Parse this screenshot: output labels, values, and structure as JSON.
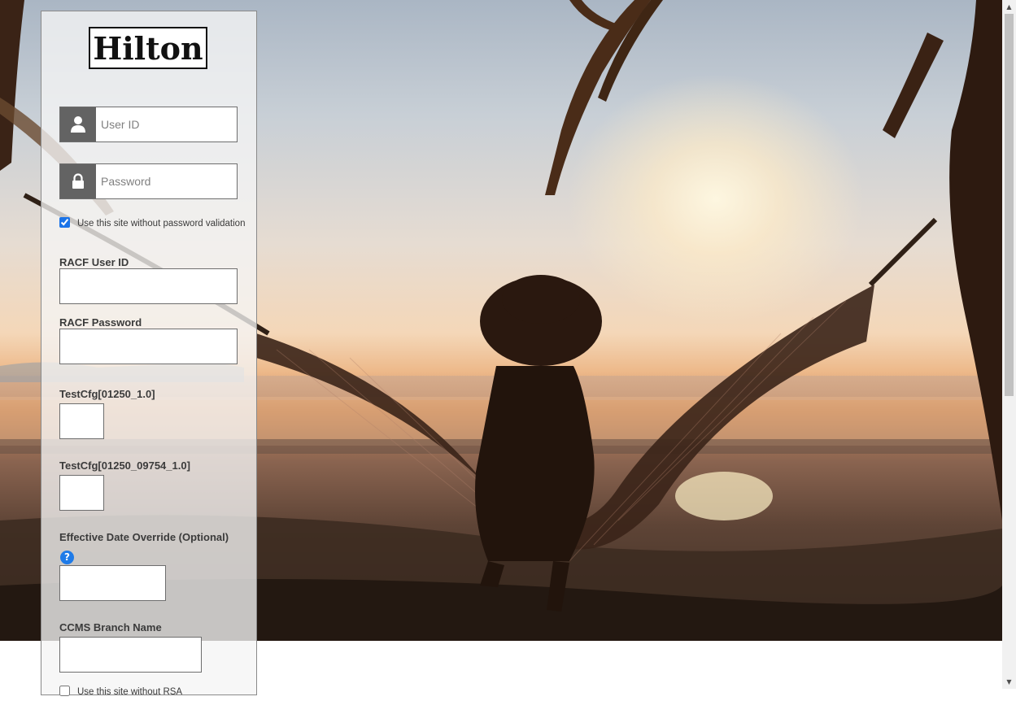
{
  "brand": {
    "logo_text": "Hilton"
  },
  "login": {
    "user_id_placeholder": "User ID",
    "password_placeholder": "Password",
    "no_password_checkbox_label": "Use this site without password validation",
    "no_password_checked": true
  },
  "fields": {
    "racf_user_id_label": "RACF User ID",
    "racf_password_label": "RACF Password",
    "testcfg_1_label": "TestCfg[01250_1.0]",
    "testcfg_2_label": "TestCfg[01250_09754_1.0]",
    "effective_date_label": "Effective Date Override (Optional)",
    "help_glyph": "?",
    "ccms_branch_label": "CCMS Branch Name",
    "rsa_checkbox_label": "Use this site without RSA"
  },
  "icons": {
    "user": "user-icon",
    "password": "lock-icon",
    "help": "help-icon"
  },
  "colors": {
    "icon_box": "#636363",
    "help_icon": "#1f7be8",
    "checkbox_accent": "#1a73e8"
  }
}
